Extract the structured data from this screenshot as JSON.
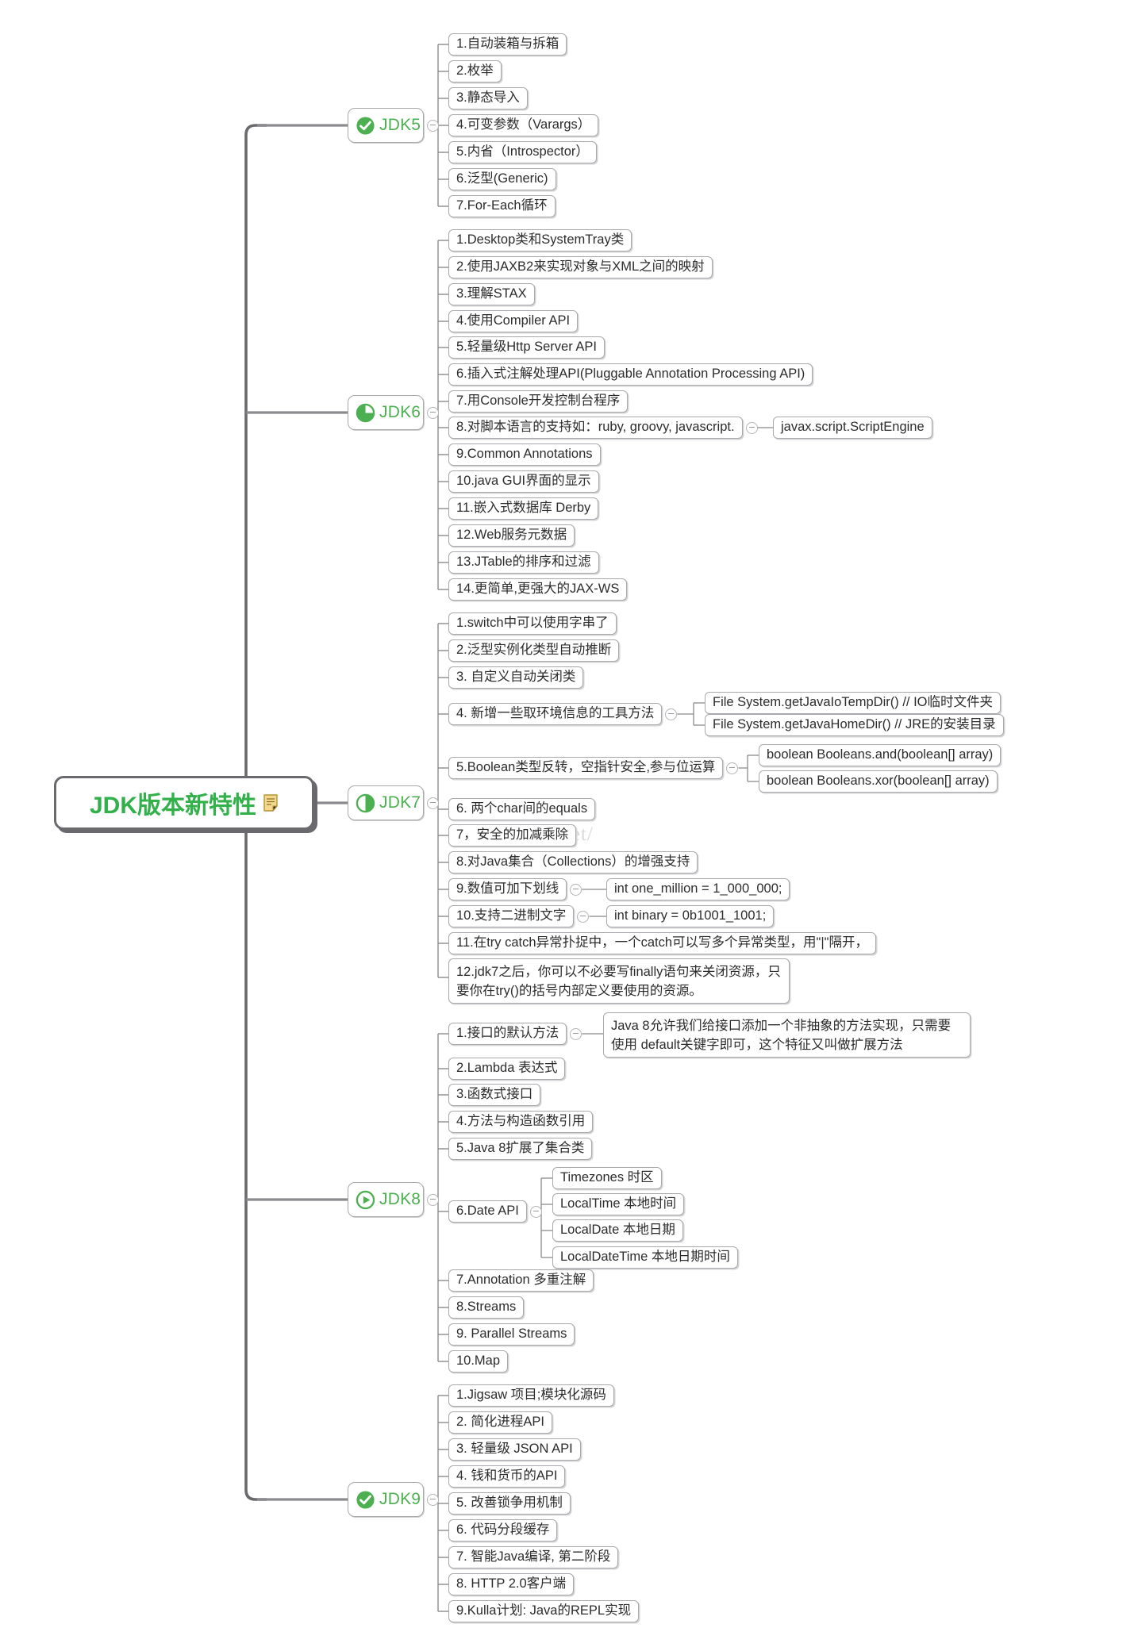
{
  "document": {
    "type": "mindmap",
    "title": "JDK版本新特性",
    "watermark": "g. csdn. net/",
    "colors": {
      "root_text": "#32b14a",
      "branch_text": "#4caf50",
      "node_border": "#a9a9ad",
      "root_border": "#6a6a6e",
      "icon_green": "#4caf50",
      "topic_text": "#2c2c2c"
    }
  },
  "root": {
    "label": "JDK版本新特性",
    "note_icon": "note-icon"
  },
  "branches": [
    {
      "label": "JDK5",
      "icon": "check-circle-icon",
      "topics": [
        {
          "text": "1.自动装箱与拆箱"
        },
        {
          "text": "2.枚举"
        },
        {
          "text": "3.静态导入"
        },
        {
          "text": "4.可变参数（Varargs）"
        },
        {
          "text": "5.内省（Introspector）"
        },
        {
          "text": "6.泛型(Generic)"
        },
        {
          "text": "7.For-Each循环"
        }
      ]
    },
    {
      "label": "JDK6",
      "icon": "pie-progress-icon",
      "topics": [
        {
          "text": "1.Desktop类和SystemTray类"
        },
        {
          "text": "2.使用JAXB2来实现对象与XML之间的映射"
        },
        {
          "text": "3.理解STAX"
        },
        {
          "text": "4.使用Compiler API"
        },
        {
          "text": "5.轻量级Http Server API"
        },
        {
          "text": "6.插入式注解处理API(Pluggable Annotation Processing API)"
        },
        {
          "text": "7.用Console开发控制台程序"
        },
        {
          "text": "8.对脚本语言的支持如：ruby, groovy, javascript.",
          "children": [
            "javax.script.ScriptEngine"
          ]
        },
        {
          "text": "9.Common Annotations"
        },
        {
          "text": "10.java GUI界面的显示"
        },
        {
          "text": "11.嵌入式数据库 Derby"
        },
        {
          "text": "12.Web服务元数据"
        },
        {
          "text": "13.JTable的排序和过滤"
        },
        {
          "text": "14.更简单,更强大的JAX-WS"
        }
      ]
    },
    {
      "label": "JDK7",
      "icon": "half-circle-icon",
      "topics": [
        {
          "text": "1.switch中可以使用字串了"
        },
        {
          "text": "2.泛型实例化类型自动推断"
        },
        {
          "text": "3. 自定义自动关闭类"
        },
        {
          "text": "4. 新增一些取环境信息的工具方法",
          "children": [
            "File System.getJavaIoTempDir() // IO临时文件夹",
            "File System.getJavaHomeDir() // JRE的安装目录"
          ]
        },
        {
          "text": "5.Boolean类型反转，空指针安全,参与位运算",
          "children": [
            "boolean Booleans.and(boolean[] array)",
            "boolean Booleans.xor(boolean[] array)"
          ]
        },
        {
          "text": "6. 两个char间的equals"
        },
        {
          "text": "7，安全的加减乘除"
        },
        {
          "text": "8.对Java集合（Collections）的增强支持"
        },
        {
          "text": "9.数值可加下划线",
          "children": [
            "int one_million = 1_000_000;"
          ]
        },
        {
          "text": "10.支持二进制文字",
          "children": [
            "int binary = 0b1001_1001;"
          ]
        },
        {
          "text": "11.在try catch异常扑捉中，一个catch可以写多个异常类型，用\"|\"隔开，"
        },
        {
          "text": "12.jdk7之后，你可以不必要写finally语句来关闭资源，只要你在try()的括号内部定义要使用的资源。",
          "multiline": true
        }
      ]
    },
    {
      "label": "JDK8",
      "icon": "play-circle-icon",
      "topics": [
        {
          "text": "1.接口的默认方法",
          "children": [
            "Java 8允许我们给接口添加一个非抽象的方法实现，只需要使用 default关键字即可，这个特征又叫做扩展方法"
          ]
        },
        {
          "text": "2.Lambda 表达式"
        },
        {
          "text": "3.函数式接口"
        },
        {
          "text": "4.方法与构造函数引用"
        },
        {
          "text": "5.Java 8扩展了集合类"
        },
        {
          "text": "6.Date API",
          "children": [
            "Timezones 时区",
            "LocalTime 本地时间",
            "LocalDate 本地日期",
            "LocalDateTime 本地日期时间"
          ]
        },
        {
          "text": "7.Annotation 多重注解"
        },
        {
          "text": "8.Streams"
        },
        {
          "text": "9. Parallel Streams"
        },
        {
          "text": "10.Map"
        }
      ]
    },
    {
      "label": "JDK9",
      "icon": "check-circle-icon",
      "topics": [
        {
          "text": "1.Jigsaw 项目;模块化源码"
        },
        {
          "text": "2. 简化进程API"
        },
        {
          "text": "3. 轻量级 JSON API"
        },
        {
          "text": "4. 钱和货币的API"
        },
        {
          "text": "5. 改善锁争用机制"
        },
        {
          "text": "6. 代码分段缓存"
        },
        {
          "text": "7. 智能Java编译, 第二阶段"
        },
        {
          "text": "8. HTTP 2.0客户端"
        },
        {
          "text": "9.Kulla计划: Java的REPL实现"
        }
      ]
    }
  ]
}
